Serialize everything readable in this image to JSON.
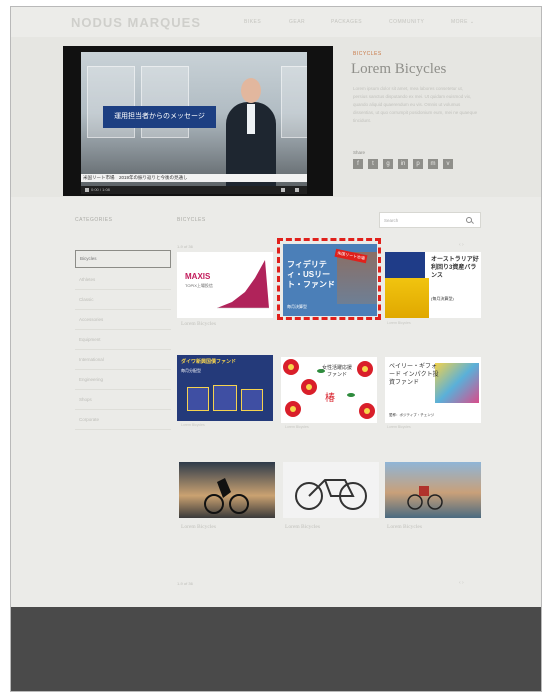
{
  "header": {
    "logo": "NODUS MARQUES",
    "nav": [
      "BIKES",
      "GEAR",
      "PACKAGES",
      "COMMUNITY",
      "MORE ⌄"
    ]
  },
  "video": {
    "message": "運用担当者からのメッセージ",
    "caption": "米国リート市場　2019年の振り返りと今後の見通し",
    "controls_time": "0:00 / 1:08"
  },
  "product": {
    "category": "BICYCLES",
    "title": "Lorem Bicycles",
    "description": "Lorem ipsum dolor sit amet, mea labores consetetur ut, persius sanctus disputando ex mei. Ut quidam euismod vix, quando aliquid quaerendum eu vis. Omnis ut volumus dissentias, ut quo corrumpit posidonium eum, mei ne quaeque tincidunt.",
    "share_label": "Share",
    "socials": [
      "f",
      "t",
      "g",
      "in",
      "p",
      "m",
      "v"
    ]
  },
  "sidebar": {
    "title": "CATEGORIES",
    "items": [
      "Bicycles",
      "Athletes",
      "Classic",
      "Accessories",
      "Equipment",
      "International",
      "Engineering",
      "Shops",
      "Corporate"
    ]
  },
  "main": {
    "title": "BICYCLES",
    "search_placeholder": "Search",
    "count": "1-9 of 36",
    "pager_top": "‹  ›",
    "pager_bottom": "‹  ›",
    "count_bottom": "1-9 of 36"
  },
  "products": [
    {
      "name": "Lorem Bicycles",
      "image_text": "MAXIS",
      "image_sub": "TOPIX上場投信"
    },
    {
      "name": "Lorem Bicycles",
      "image_text": "フィデリティ・USリート・ファンド",
      "image_sub": "毎月決算型",
      "badge": "米国リート市場"
    },
    {
      "name": "Lorem Bicycles",
      "image_text": "オーストラリア好利回り3資産バランス",
      "image_sub": "(毎月決算型)"
    },
    {
      "name": "Lorem Bicycles",
      "image_text": "ダイワ新興国債ファンド",
      "image_sub": "毎月分配型"
    },
    {
      "name": "Lorem Bicycles",
      "image_text": "女性活躍応援ファンド",
      "image_sub": "椿"
    },
    {
      "name": "Lorem Bicycles",
      "image_text": "ベイリー・ギフォード インパクト投資ファンド",
      "image_sub": "愛称：ポジティブ・チェンジ"
    },
    {
      "name": "Lorem Bicycles"
    },
    {
      "name": "Lorem Bicycles"
    },
    {
      "name": "Lorem Bicycles"
    }
  ],
  "colors": {
    "highlight": "#e0201b",
    "accent": "#c97a48",
    "footer": "#4a4a4a",
    "video_banner": "#1d3f82"
  }
}
